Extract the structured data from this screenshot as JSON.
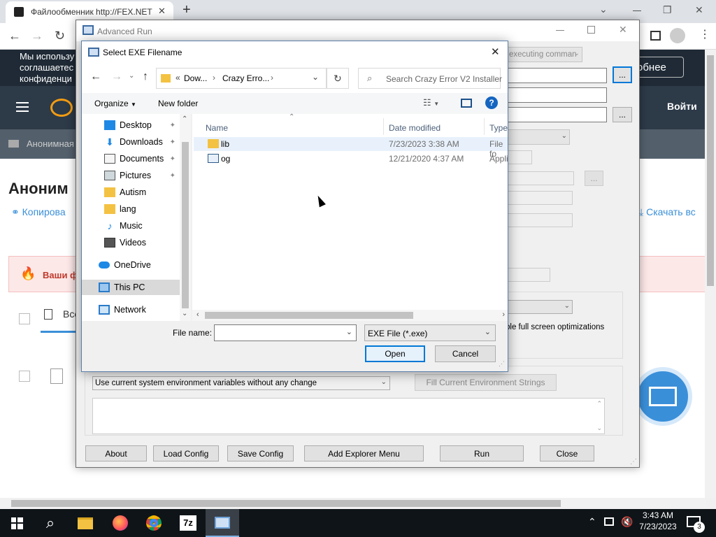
{
  "browser": {
    "tab_title": "Файлообменник http://FEX.NET",
    "new_tab": "+",
    "win_min": "⌄",
    "win_restore": "❐",
    "win_close": "✕"
  },
  "site": {
    "banner_line1": "Мы использу",
    "banner_line2": "соглашаетес",
    "banner_line3": "конфиденци",
    "banner_button": "обнее",
    "login": "Войти",
    "crumb": "Анонимная",
    "heading": "Аноним",
    "copy_link": "Копирова",
    "download_all": "Скачать вс",
    "alert": "Ваши ф",
    "tab_all": "Все"
  },
  "advanced_run": {
    "title": "Advanced Run",
    "exec_combo": "executing comman",
    "browse": "...",
    "fullscreen_label": "ble full screen optimizations",
    "env_select": "Use current system environment variables without any change",
    "fill_env_button": "Fill Current Environment Strings",
    "buttons": {
      "about": "About",
      "load_config": "Load Config",
      "save_config": "Save Config",
      "add_explorer_menu": "Add Explorer Menu",
      "run": "Run",
      "close": "Close"
    }
  },
  "dialog": {
    "title": "Select EXE Filename",
    "breadcrumb": {
      "prefix": "«",
      "part1": "Dow...",
      "part2": "Crazy Erro...",
      "sep": "›"
    },
    "search_placeholder": "Search Crazy Error V2 Installer",
    "organize": "Organize",
    "new_folder": "New folder",
    "nav_items": [
      {
        "label": "Desktop"
      },
      {
        "label": "Downloads"
      },
      {
        "label": "Documents"
      },
      {
        "label": "Pictures"
      },
      {
        "label": "Autism"
      },
      {
        "label": "lang"
      },
      {
        "label": "Music"
      },
      {
        "label": "Videos"
      },
      {
        "label": "OneDrive"
      },
      {
        "label": "This PC"
      },
      {
        "label": "Network"
      }
    ],
    "columns": {
      "name": "Name",
      "date": "Date modified",
      "type": "Type"
    },
    "files": [
      {
        "name": "lib",
        "date": "7/23/2023 3:38 AM",
        "type": "File fo"
      },
      {
        "name": "og",
        "date": "12/21/2020 4:37 AM",
        "type": "Appli"
      }
    ],
    "file_name_label": "File name:",
    "file_name_value": "",
    "file_type": "EXE File (*.exe)",
    "open": "Open",
    "cancel": "Cancel"
  },
  "taskbar": {
    "time": "3:43 AM",
    "date": "7/23/2023",
    "notification_count": "3",
    "sevenzip": "7z"
  }
}
